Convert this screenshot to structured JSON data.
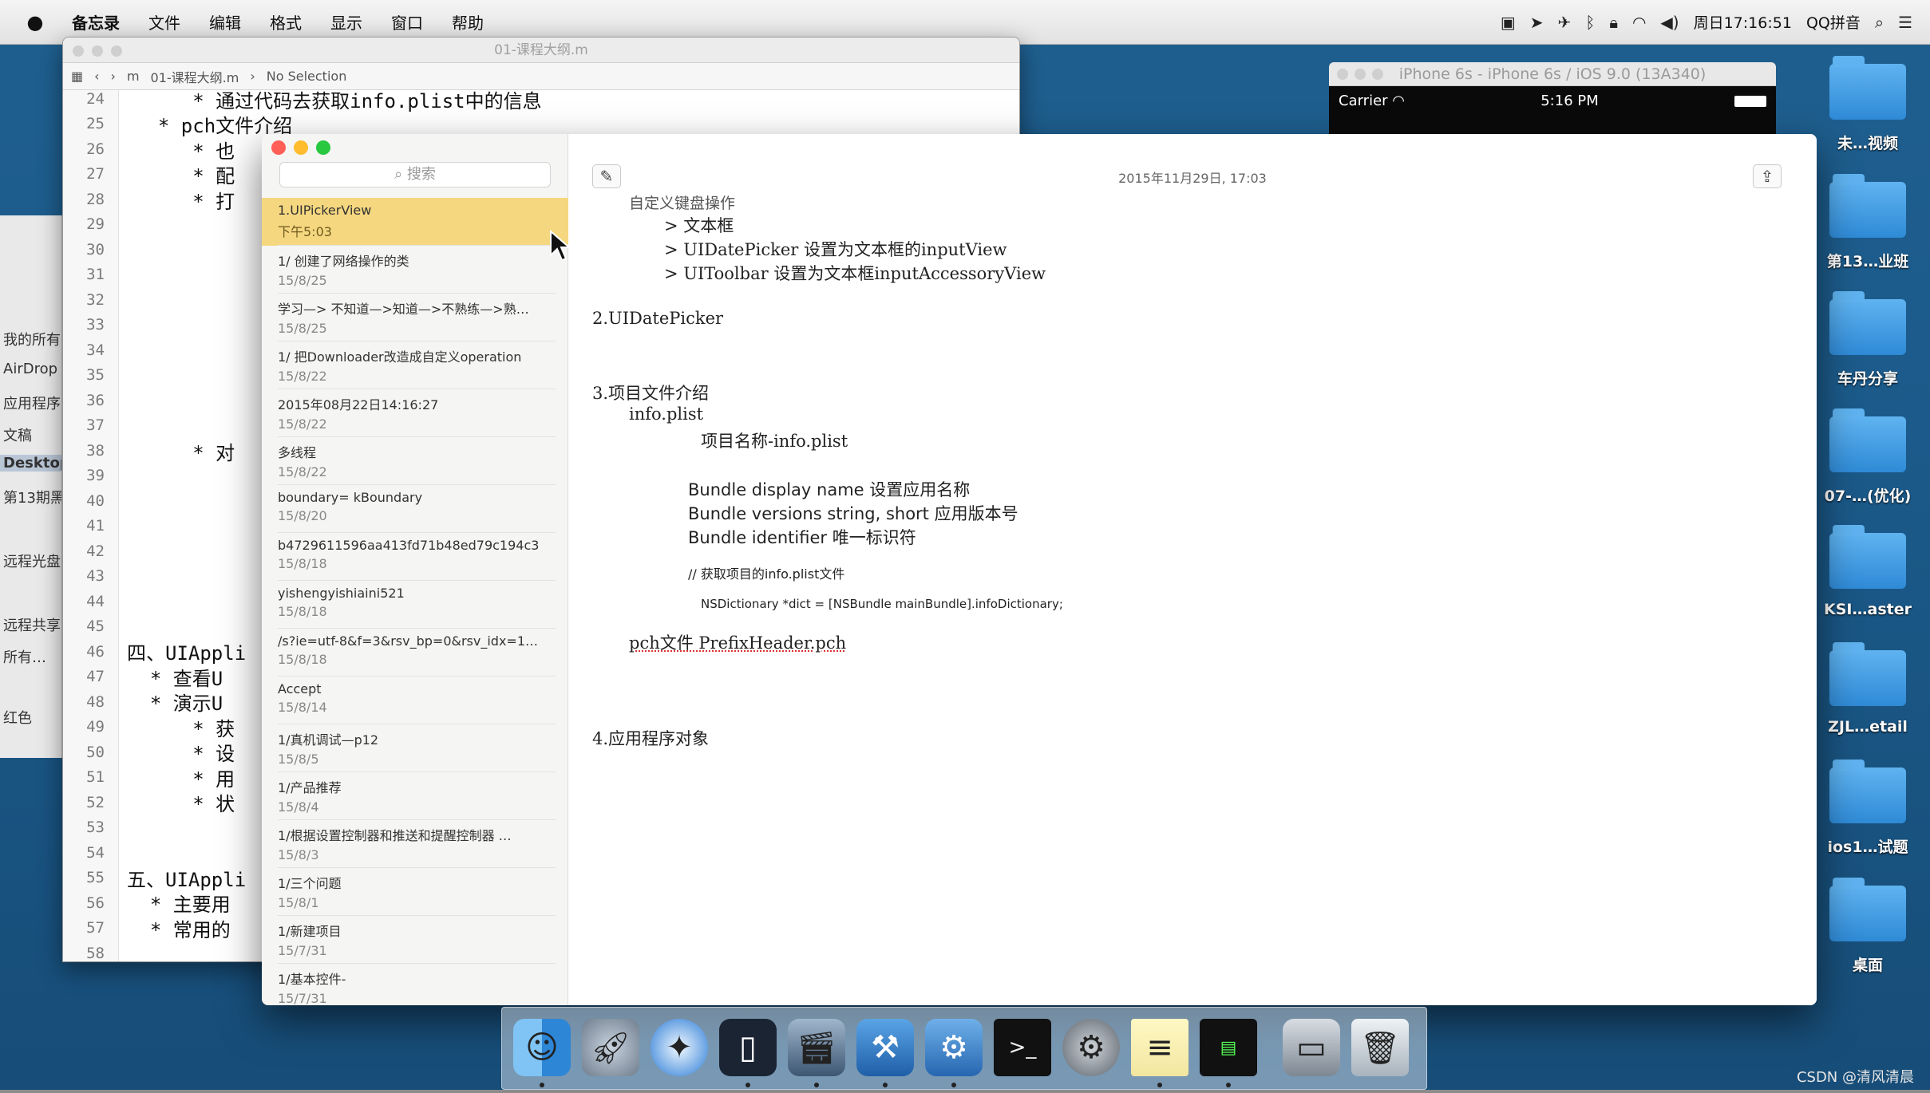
{
  "menubar": {
    "apple": "",
    "items": [
      "备忘录",
      "文件",
      "编辑",
      "格式",
      "显示",
      "窗口",
      "帮助"
    ],
    "clock": "周日17:16:51",
    "input_method": "QQ拼音"
  },
  "desktop": {
    "folders": [
      "未…视频",
      "第13…业班",
      "车丹分享",
      "07-…(优化)",
      "KSI…aster",
      "ZJL…etail",
      "ios1…试题",
      "桌面"
    ]
  },
  "finder_sidebar": [
    "我的所有",
    "AirDrop",
    "应用程序",
    "文稿",
    "Desktop",
    "第13期黑",
    "远程光盘",
    "远程共享",
    "所有…",
    "红色"
  ],
  "xcode": {
    "title": "01-课程大纲.m",
    "breadcrumb_file": "01-课程大纲.m",
    "breadcrumb_sel": "No Selection",
    "line_numbers": [
      "24",
      "25",
      "26",
      "27",
      "28",
      "29",
      "30",
      "31",
      "32",
      "33",
      "34",
      "35",
      "36",
      "37",
      "38",
      "39",
      "40",
      "41",
      "42",
      "43",
      "44",
      "45",
      "46",
      "47",
      "48",
      "49",
      "50",
      "51",
      "52",
      "53",
      "54",
      "55",
      "56",
      "57",
      "58"
    ],
    "lines": [
      "     * 通过代码去获取info.plist中的信息",
      "  * pch文件介绍",
      "     * 也",
      "     * 配",
      "     * 打",
      "     * 对",
      "四、UIAppli",
      "  * 查看U",
      "  * 演示U",
      "     * 获",
      "     * 设",
      "     * 用",
      "     * 状",
      "五、UIAppli",
      "  * 主要用",
      "  * 常用的"
    ]
  },
  "simulator": {
    "title": "iPhone 6s - iPhone 6s / iOS 9.0 (13A340)",
    "carrier": "Carrier",
    "time": "5:16 PM"
  },
  "notes": {
    "search_placeholder": "搜索",
    "list": [
      {
        "title": "1.UIPickerView",
        "date": "下午5:03"
      },
      {
        "title": "1/ 创建了网络操作的类",
        "date": "15/8/25"
      },
      {
        "title": "学习—> 不知道—>知道—>不熟练—>熟…",
        "date": "15/8/25"
      },
      {
        "title": "1/ 把Downloader改造成自定义operation",
        "date": "15/8/22"
      },
      {
        "title": "2015年08月22日14:16:27",
        "date": "15/8/22"
      },
      {
        "title": "多线程",
        "date": "15/8/22"
      },
      {
        "title": "boundary= kBoundary",
        "date": "15/8/20"
      },
      {
        "title": "b4729611596aa413fd71b48ed79c194c3",
        "date": "15/8/18"
      },
      {
        "title": "yishengyishiaini521",
        "date": "15/8/18"
      },
      {
        "title": "/s?ie=utf-8&f=3&rsv_bp=0&rsv_idx=1…",
        "date": "15/8/18"
      },
      {
        "title": "Accept",
        "date": "15/8/14"
      },
      {
        "title": "1/真机调试—p12",
        "date": "15/8/5"
      },
      {
        "title": "1/产品推荐",
        "date": "15/8/4"
      },
      {
        "title": "1/根据设置控制器和推送和提醒控制器 …",
        "date": "15/8/3"
      },
      {
        "title": "1/三个问题",
        "date": "15/8/1"
      },
      {
        "title": "1/新建项目",
        "date": "15/7/31"
      },
      {
        "title": "1/基本控件-",
        "date": "15/7/31"
      }
    ],
    "editor": {
      "timestamp": "2015年11月29日, 17:03",
      "lines": [
        "自定义键盘操作",
        "> 文本框",
        "> UIDatePicker 设置为文本框的inputView",
        "> UIToolbar 设置为文本框inputAccessoryView",
        "2.UIDatePicker",
        "3.项目文件介绍",
        "info.plist",
        "项目名称-info.plist",
        "Bundle display name 设置应用名称",
        "Bundle versions string, short 应用版本号",
        "Bundle identifier 唯一标识符",
        "// 获取项目的info.plist文件",
        "NSDictionary *dict = [NSBundle mainBundle].infoDictionary;",
        "pch文件 PrefixHeader.pch",
        "4.应用程序对象"
      ]
    }
  },
  "dock": {
    "apps": [
      "finder-icon",
      "launchpad-icon",
      "safari-icon",
      "mouse-icon",
      "imovie-icon",
      "xcode-icon",
      "instruments-icon",
      "terminal-icon",
      "system-preferences-icon",
      "notes-icon",
      "console-icon",
      "simulator-icon",
      "trash-icon"
    ]
  },
  "watermark": "CSDN @清风清晨"
}
